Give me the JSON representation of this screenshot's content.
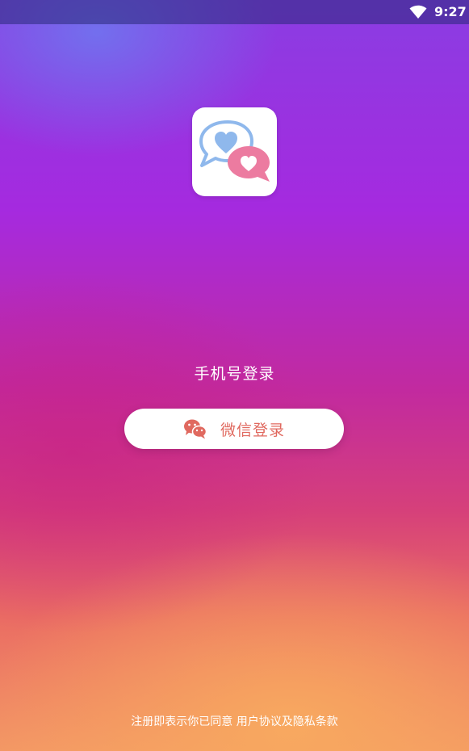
{
  "status_bar": {
    "wifi_icon": "wifi-icon",
    "time": "9:27"
  },
  "logo": {
    "icon": "chat-hearts-icon",
    "colors": {
      "blue_bubble": "#8fb8ec",
      "pink_bubble": "#ec7ba0"
    }
  },
  "actions": {
    "phone_login": "手机号登录",
    "wechat_login": "微信登录",
    "wechat_icon": "wechat-icon",
    "wechat_color": "#e0695f"
  },
  "agreement": {
    "prefix": "注册即表示你已同意",
    "terms_link": "用户协议及隐私条款"
  }
}
